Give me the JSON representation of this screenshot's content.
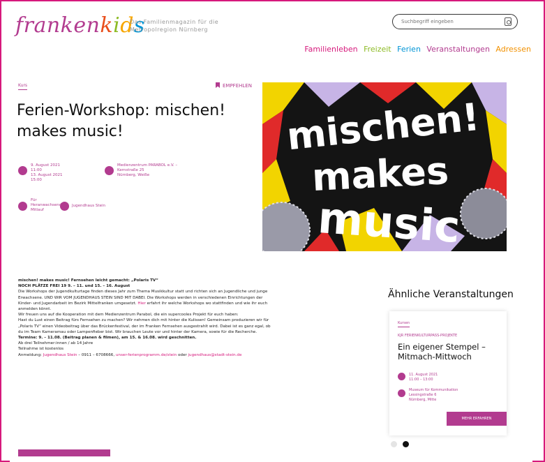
{
  "header": {
    "logo_parts": [
      "franken",
      "k",
      "i",
      "d",
      "s"
    ],
    "tagline_line1": "Das Familienmagazin für die",
    "tagline_line2": "Metropolregion Nürnberg",
    "search_placeholder": "Suchbegriff eingeben"
  },
  "nav": [
    "Familienleben",
    "Freizeit",
    "Ferien",
    "Veranstaltungen",
    "Adressen"
  ],
  "event": {
    "category": "Kurs",
    "bookmark_label": "EMPFEHLEN",
    "title_line1": "Ferien-Workshop: mischen!",
    "title_line2": "makes music!",
    "date_lines": [
      "9. August 2021",
      "11:00",
      "13. August 2021",
      "15:00"
    ],
    "location_lines": [
      "Medienzentrum PARABOL e.V. –",
      "Kernstraße 25",
      "Nürnberg, Weiße"
    ],
    "audience_lines": [
      "Für",
      "Heranwachsende",
      "Mitlauf"
    ],
    "venue": "Jugendhaus Stein"
  },
  "poster": {
    "line1": "mischen!",
    "line2": "makes",
    "line3": "music"
  },
  "body": {
    "heading": "mischen! makes music! Fernsehen leicht gemacht: „Polaris TV“",
    "headline2": "NOCH PLÄTZE FREI 19 9. – 11. und 15. – 16. August",
    "p1": "Die Workshops der Jugendkulturtage finden dieses Jahr zum Thema Musikkultur statt und richten sich an Jugendliche und junge",
    "p1b": "Erwachsene. UND WIR VOM JUGENDHAUS STEIN SIND MIT DABEI. Die Workshops werden in verschiedenen Einrichtungen der",
    "p1c": "Kinder- und Jugendarbeit im Bezirk Mittelfranken umgesetzt.",
    "p1_link": "Hier",
    "p1d": "erfahrt ihr welche Workshops wo stattfinden und wie ihr euch",
    "p1e": "anmelden könnt.",
    "p2": "Wir freuen uns auf die Kooperation mit dem Medienzentrum Parabol, die ein supercooles Projekt für euch haben:",
    "p3": "Hast du Lust einen Beitrag fürs Fernsehen zu machen? Wir nehmen dich mit hinter die Kulissen! Gemeinsam produzieren wir für",
    "p3b": "„Polaris TV“ einen Videobeitrag über das Brückenfestival, der im Franken Fernsehen ausgestrahlt wird. Dabei ist es ganz egal, ob",
    "p3c": "du im Team Kameramau oder Lampenfieber bist. Wir brauchen Leute vor und hinter der Kamera, sowie für die Recherche.",
    "p4": "Termine: 9. – 11.08. (Beitrag planen & filmen), am 15. & 16.08. wird geschnitten.",
    "p5": "Ab drei Teilnehmer:innen / ab 14 Jahre",
    "p6": "Teilnahme ist kostenlos",
    "p7_label": "Anmeldung:",
    "p7_link1": "Jugendhaus Stein",
    "p7_phone": "– 0911 – 6708666,",
    "p7_link2": "unser-ferienprogramm.de/stein",
    "p7_mid": "oder",
    "p7_link3": "jugendhaus@stadt-stein.de"
  },
  "sidebar": {
    "title": "Ähnliche Veranstaltungen",
    "card": {
      "category": "Kursen",
      "org": "KJR FERIENKULTURPASS-PROJEKTE",
      "title": "Ein eigener Stempel – Mitmach-Mittwoch",
      "date_lines": [
        "11. August 2021",
        "11:00 – 13:00"
      ],
      "location_lines": [
        "Museum für Kommunikation",
        "Lessingstraße 6",
        "Nürnberg, Mitte"
      ],
      "button": "MEHR ERFAHREN"
    }
  },
  "colors": {
    "accent": "#b23b8f",
    "frame": "#d6197c",
    "nav_familienleben": "#d6197c",
    "nav_freizeit": "#8dbb25",
    "nav_ferien": "#0095d6",
    "nav_veranstaltungen": "#b23b8f",
    "nav_adressen": "#f29100"
  }
}
